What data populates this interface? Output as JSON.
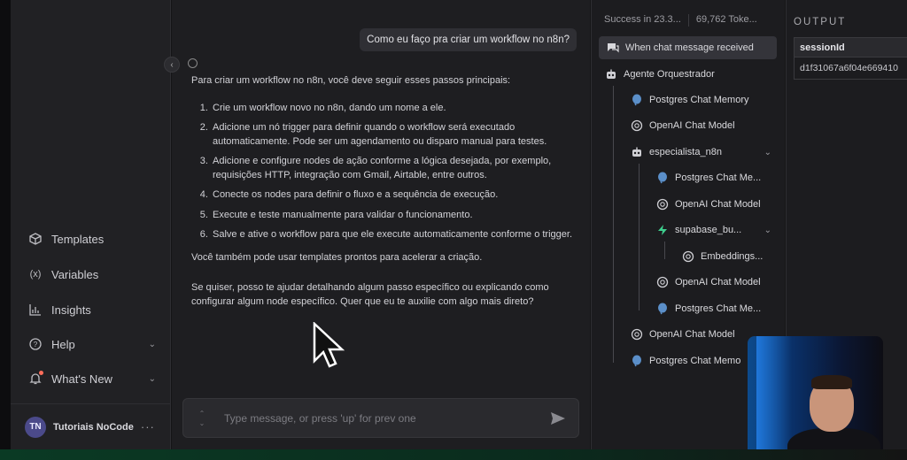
{
  "sidebar": {
    "items": [
      {
        "label": "Templates",
        "icon": "box-icon"
      },
      {
        "label": "Variables",
        "icon": "variable-icon"
      },
      {
        "label": "Insights",
        "icon": "chart-icon"
      },
      {
        "label": "Help",
        "icon": "help-icon"
      },
      {
        "label": "What's New",
        "icon": "bell-icon"
      }
    ],
    "user": {
      "initials": "TN",
      "name": "Tutoriais NoCode"
    }
  },
  "chat": {
    "user_message": "Como eu faço pra criar um workflow no n8n?",
    "reply": {
      "intro": "Para criar um workflow no n8n, você deve seguir esses passos principais:",
      "steps": [
        "Crie um workflow novo no n8n, dando um nome a ele.",
        "Adicione um nó trigger para definir quando o workflow será executado automaticamente. Pode ser um agendamento ou disparo manual para testes.",
        "Adicione e configure nodes de ação conforme a lógica desejada, por exemplo, requisições HTTP, integração com Gmail, Airtable, entre outros.",
        "Conecte os nodes para definir o fluxo e a sequência de execução.",
        "Execute e teste manualmente para validar o funcionamento.",
        "Salve e ative o workflow para que ele execute automaticamente conforme o trigger."
      ],
      "p2": "Você também pode usar templates prontos para acelerar a criação.",
      "p3": "Se quiser, posso te ajudar detalhando algum passo específico ou explicando como configurar algum node específico. Quer que eu te auxilie com algo mais direto?"
    },
    "input_placeholder": "Type message, or press 'up' for prev one"
  },
  "logs": {
    "status": "Success in 23.3...",
    "tokens": "69,762 Toke...",
    "nodes": [
      {
        "label": "When chat message received",
        "icon": "chat-icon"
      },
      {
        "label": "Agente Orquestrador",
        "icon": "robot-icon"
      },
      {
        "label": "Postgres Chat Memory",
        "icon": "postgres-icon"
      },
      {
        "label": "OpenAI Chat Model",
        "icon": "openai-icon"
      },
      {
        "label": "especialista_n8n",
        "icon": "robot-icon"
      },
      {
        "label": "Postgres Chat Me...",
        "icon": "postgres-icon"
      },
      {
        "label": "OpenAI Chat Model",
        "icon": "openai-icon"
      },
      {
        "label": "supabase_bu...",
        "icon": "supabase-icon"
      },
      {
        "label": "Embeddings...",
        "icon": "openai-icon"
      },
      {
        "label": "OpenAI Chat Model",
        "icon": "openai-icon"
      },
      {
        "label": "Postgres Chat Me...",
        "icon": "postgres-icon"
      },
      {
        "label": "OpenAI Chat Model",
        "icon": "openai-icon"
      },
      {
        "label": "Postgres Chat Memo",
        "icon": "postgres-icon"
      }
    ]
  },
  "output": {
    "title": "OUTPUT",
    "column": "sessionId",
    "value": "d1f31067a6f04e669410"
  },
  "colors": {
    "accent": "#ff6d5a",
    "supabase": "#3ecf8e",
    "postgres": "#5b8fc9"
  }
}
